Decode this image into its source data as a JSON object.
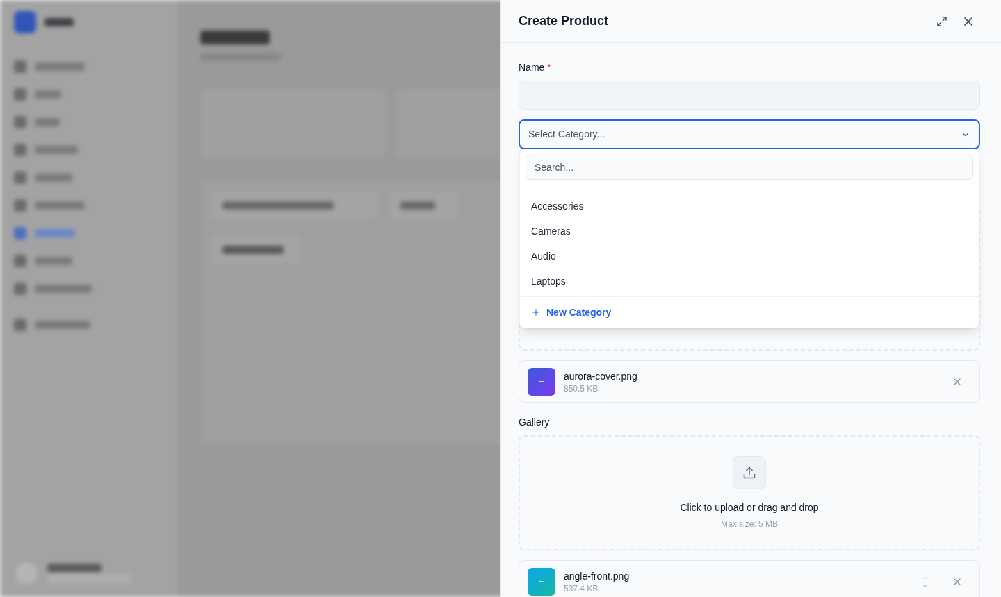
{
  "drawer": {
    "title": "Create Product",
    "name_field": {
      "label": "Name",
      "required_mark": "*"
    },
    "category_select": {
      "placeholder": "Select Category...",
      "expanded": true,
      "search_placeholder": "Search...",
      "options": [
        "Accessories",
        "Cameras",
        "Audio",
        "Laptops"
      ],
      "create_label": "New Category"
    },
    "cover_files": [
      {
        "name": "aurora-cover.png",
        "size": "850.5 KB",
        "reorder_controls": false
      }
    ],
    "gallery": {
      "label": "Gallery",
      "upload_text": "Click to upload or drag and drop",
      "limit": "Max size: 5 MB"
    },
    "gallery_files": [
      {
        "name": "angle-front.png",
        "size": "537.4 KB",
        "reorder_controls": true
      }
    ]
  }
}
